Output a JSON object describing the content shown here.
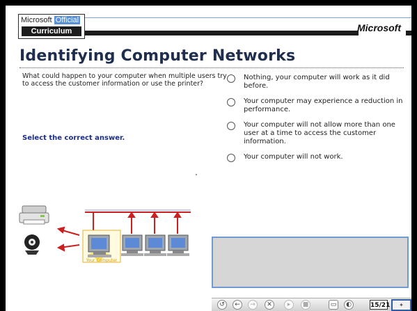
{
  "header": {
    "logo_line1_a": "Microsoft",
    "logo_line1_b": "Official",
    "logo_line2": "Curriculum",
    "brand": "Microsoft"
  },
  "slide": {
    "title": "Identifying Computer Networks",
    "question": "What could happen to your computer when multiple users try to access the customer information or use the printer?",
    "instruction": "Select the correct answer.",
    "answers": [
      {
        "label": "Nothing, your computer will work as it did before."
      },
      {
        "label": "Your computer may experience a reduction in performance."
      },
      {
        "label": "Your computer will not allow more than one user at a time to access the customer information."
      },
      {
        "label": "Your computer will not work."
      }
    ],
    "diagram": {
      "computer_label": "Your Computer"
    }
  },
  "toolbar": {
    "page": "15/21"
  },
  "colors": {
    "title": "#1f2e4d",
    "instruction": "#1b2d8a",
    "arrow_red": "#cc1f1f",
    "accent_blue": "#6f9bd2"
  }
}
